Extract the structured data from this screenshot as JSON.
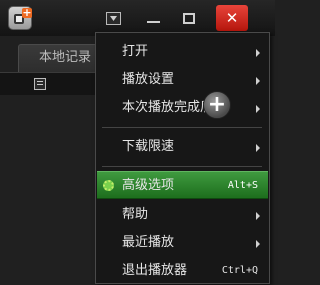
{
  "left_panel": {
    "tab_label": "本地记录"
  },
  "menu": {
    "items": [
      {
        "label": "打开",
        "submenu": true
      },
      {
        "label": "播放设置",
        "submenu": true
      },
      {
        "label": "本次播放完成后",
        "submenu": true
      },
      {
        "label": "下载限速",
        "submenu": true
      },
      {
        "label": "高级选项",
        "shortcut": "Alt+S",
        "highlighted": true
      },
      {
        "label": "帮助",
        "submenu": true
      },
      {
        "label": "最近播放",
        "submenu": true
      },
      {
        "label": "退出播放器",
        "shortcut": "Ctrl+Q"
      }
    ]
  },
  "colors": {
    "highlight": "#2a7f2a",
    "close_button": "#d32a20",
    "logo_accent": "#ee6a22"
  }
}
